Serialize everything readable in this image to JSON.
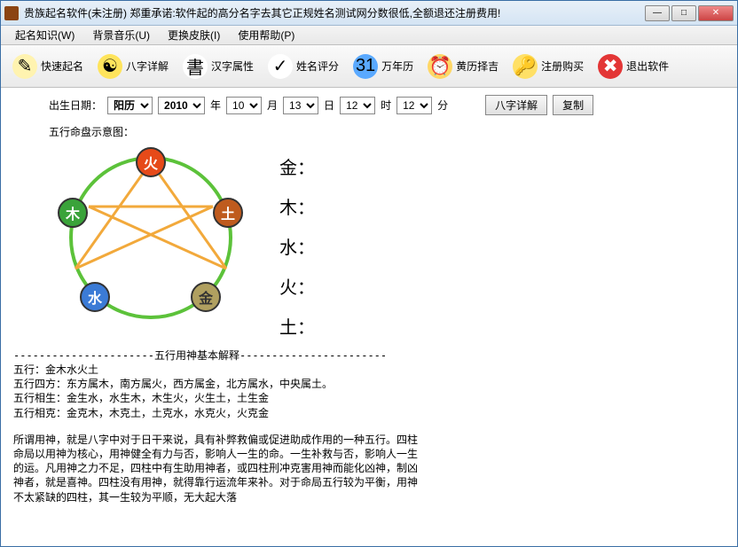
{
  "window": {
    "title": "贵族起名软件(未注册)    郑重承诺:软件起的高分名字去其它正规姓名测试网分数很低,全额退还注册费用!"
  },
  "menus": [
    {
      "label": "起名知识(W)"
    },
    {
      "label": "背景音乐(U)"
    },
    {
      "label": "更换皮肤(I)"
    },
    {
      "label": "使用帮助(P)"
    }
  ],
  "toolbar": [
    {
      "label": "快速起名",
      "iconBg": "#fff3b0",
      "glyph": "✎"
    },
    {
      "label": "八字详解",
      "iconBg": "#ffe45c",
      "glyph": "☯"
    },
    {
      "label": "汉字属性",
      "iconBg": "#ffffff",
      "glyph": "書"
    },
    {
      "label": "姓名评分",
      "iconBg": "#ffffff",
      "glyph": "✓"
    },
    {
      "label": "万年历",
      "iconBg": "#5aa9ff",
      "glyph": "31"
    },
    {
      "label": "黄历择吉",
      "iconBg": "#ffd766",
      "glyph": "⏰"
    },
    {
      "label": "注册购买",
      "iconBg": "#ffe066",
      "glyph": "🔑"
    },
    {
      "label": "退出软件",
      "iconBg": "#e33636",
      "glyph": "✖"
    }
  ],
  "dateRow": {
    "label": "出生日期：",
    "calType": "阳历",
    "year": "2010",
    "yearSuffix": "年",
    "month": "10",
    "monthSuffix": "月",
    "day": "13",
    "daySuffix": "日",
    "hour": "12",
    "hourSuffix": "时",
    "minute": "12",
    "minuteSuffix": "分",
    "btnDetail": "八字详解",
    "btnCopy": "复制"
  },
  "diagram": {
    "title": "五行命盘示意图：",
    "nodes": {
      "fire": "火",
      "earth": "土",
      "metal": "金",
      "water": "水",
      "wood": "木"
    },
    "edgeOuter": "生",
    "edgeInner": "克",
    "elementsList": [
      "金：",
      "木：",
      "水：",
      "火：",
      "土："
    ]
  },
  "explanation": {
    "dividerTitle": "五行用神基本解释",
    "lines": [
      "五行：金木水火土",
      "五行四方：东方属木，南方属火，西方属金，北方属水，中央属土。",
      "五行相生：金生水，水生木，木生火，火生土，土生金",
      "五行相克：金克木，木克土，土克水，水克火，火克金"
    ],
    "paragraph": "所谓用神，就是八字中对于日干来说，具有补弊救偏或促进助成作用的一种五行。四柱命局以用神为核心，用神健全有力与否，影响人一生的命。一生补救与否，影响人一生的运。凡用神之力不足，四柱中有生助用神者，或四柱刑冲克害用神而能化凶神，制凶神者，就是喜神。四柱没有用神，就得靠行运流年来补。对于命局五行较为平衡，用神不太紧缺的四柱，其一生较为平顺，无大起大落"
  }
}
